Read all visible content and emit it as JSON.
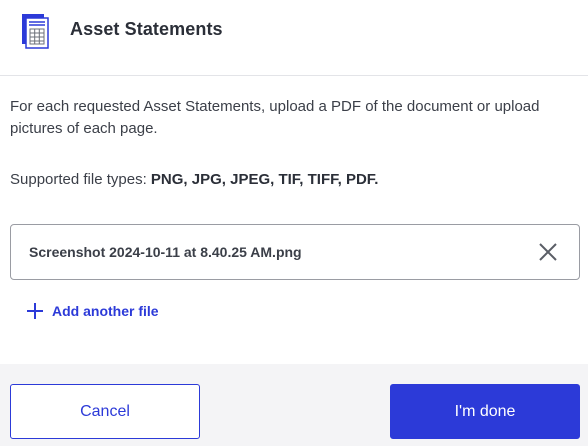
{
  "header": {
    "title": "Asset Statements",
    "icon": "document-calculator-icon"
  },
  "body": {
    "description": "For each requested Asset Statements, upload a PDF of the document or upload pictures of each page.",
    "supported_label": "Supported file types: ",
    "supported_types": "PNG, JPG, JPEG, TIF, TIFF, PDF."
  },
  "files": [
    {
      "name": "Screenshot 2024-10-11 at 8.40.25 AM.png"
    }
  ],
  "actions": {
    "add_file_label": "Add another file",
    "cancel_label": "Cancel",
    "done_label": "I'm done"
  },
  "colors": {
    "accent": "#2c3ad8",
    "footer_bg": "#f4f4f6",
    "text": "#2b2f38"
  }
}
